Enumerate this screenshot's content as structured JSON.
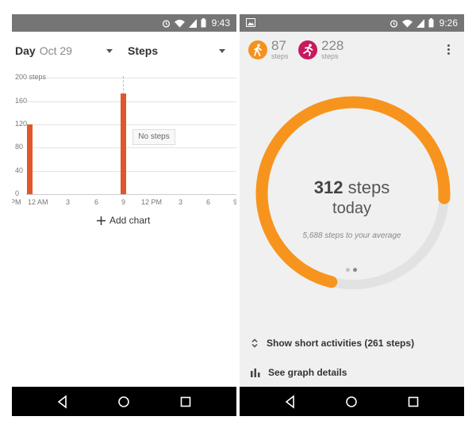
{
  "left_phone": {
    "status": {
      "time": "9:43"
    },
    "toolbar": {
      "date_label": "Day",
      "date_value": "Oct 29",
      "metric": "Steps"
    },
    "chart_data": {
      "type": "bar",
      "y_unit": "steps",
      "ylim": [
        0,
        200
      ],
      "yticks": [
        "200 steps",
        "160",
        "120",
        "80",
        "40",
        "0"
      ],
      "xticks": [
        "PM",
        "12 AM",
        "3",
        "6",
        "9",
        "12 PM",
        "3",
        "6",
        "9"
      ],
      "categories": [
        "12 AM",
        "9"
      ],
      "values": [
        120,
        173
      ]
    },
    "tooltip": "No steps",
    "add_chart": "Add chart"
  },
  "right_phone": {
    "status": {
      "time": "9:26"
    },
    "activities": [
      {
        "value": "87",
        "unit": "steps",
        "color": "#f5921e",
        "icon": "walking-icon"
      },
      {
        "value": "228",
        "unit": "steps",
        "color": "#c8195e",
        "icon": "running-icon"
      }
    ],
    "summary": {
      "steps": "312",
      "steps_unit": "steps",
      "period": "today",
      "average": "5,688 steps to your average",
      "progress": 0.72,
      "ring_color": "#f7941d"
    },
    "short_activities": "Show short activities (261 steps)",
    "graph_details": "See graph details"
  }
}
